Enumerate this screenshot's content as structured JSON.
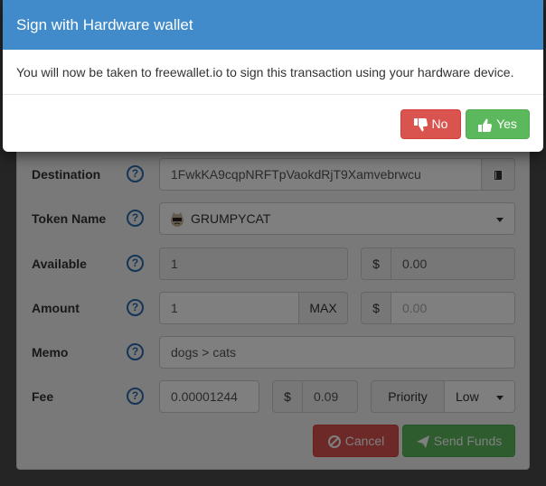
{
  "modal": {
    "title": "Sign with Hardware wallet",
    "message": "You will now be taken to freewallet.io to sign this transaction using your hardware device.",
    "no_label": "No",
    "yes_label": "Yes"
  },
  "form": {
    "destination": {
      "label": "Destination",
      "value": "1FwkKA9cqpNRFTpVaokdRjT9Xamvebrwcu"
    },
    "token": {
      "label": "Token Name",
      "value": "GRUMPYCAT"
    },
    "available": {
      "label": "Available",
      "value": "1",
      "currency_symbol": "$",
      "usd_value": "0.00"
    },
    "amount": {
      "label": "Amount",
      "value": "1",
      "max_label": "MAX",
      "currency_symbol": "$",
      "usd_placeholder": "0.00"
    },
    "memo": {
      "label": "Memo",
      "value": "dogs > cats"
    },
    "fee": {
      "label": "Fee",
      "value": "0.00001244",
      "currency_symbol": "$",
      "usd_value": "0.09",
      "priority_label": "Priority",
      "priority_value": "Low"
    },
    "help_glyph": "?",
    "cancel_label": "Cancel",
    "send_label": "Send Funds"
  },
  "colors": {
    "header_blue": "#428bca",
    "danger": "#d9534f",
    "success": "#5cb85c",
    "help_blue": "#2a6bb0"
  }
}
